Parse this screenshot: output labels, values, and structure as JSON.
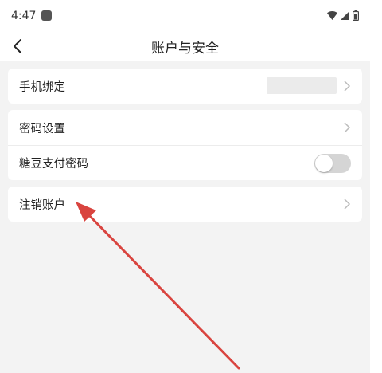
{
  "status_bar": {
    "time": "4:47",
    "icons": [
      "notification-square-icon",
      "wifi-icon",
      "signal-icon",
      "battery-icon"
    ]
  },
  "header": {
    "title": "账户与安全",
    "back_icon": "chevron-left-icon"
  },
  "sections": {
    "phone": {
      "label": "手机绑定"
    },
    "password": {
      "label": "密码设置"
    },
    "pay_password": {
      "label": "糖豆支付密码",
      "toggle_on": false
    },
    "cancel_account": {
      "label": "注销账户"
    }
  },
  "annotation": {
    "arrow_color": "#d9443f"
  },
  "colors": {
    "background": "#f3f3f3",
    "card": "#ffffff",
    "text": "#222222",
    "chevron": "#bbbbbb"
  }
}
